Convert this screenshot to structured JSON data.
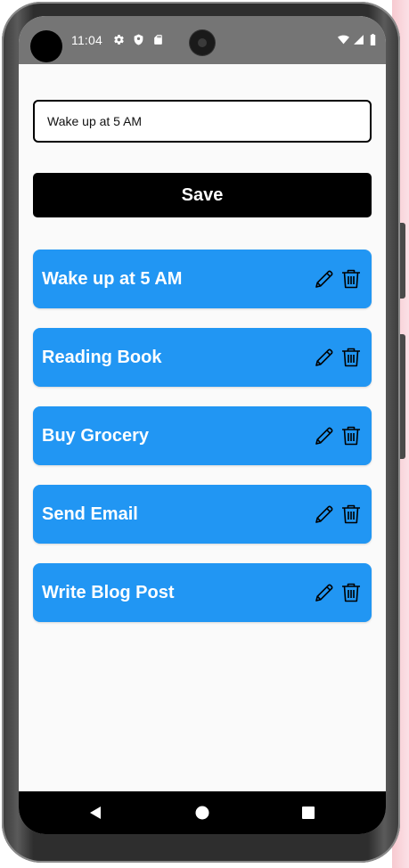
{
  "status_bar": {
    "time": "11:04",
    "icons": [
      "gear-icon",
      "shield-icon",
      "sd-card-icon",
      "wifi-icon",
      "signal-icon",
      "battery-icon"
    ]
  },
  "input": {
    "value": "Wake up at 5 AM",
    "placeholder": ""
  },
  "save_button": {
    "label": "Save"
  },
  "tasks": [
    {
      "title": "Wake up at 5 AM"
    },
    {
      "title": "Reading Book"
    },
    {
      "title": "Buy Grocery"
    },
    {
      "title": "Send Email"
    },
    {
      "title": "Write Blog Post"
    }
  ],
  "task_actions": [
    "pencil-icon",
    "trash-icon"
  ],
  "colors": {
    "card": "#2196f3",
    "save_button": "#000000",
    "status_bar": "#757575",
    "background": "#fafafa"
  },
  "nav_bar": {
    "icons": [
      "back-icon",
      "home-icon",
      "recents-icon"
    ]
  }
}
